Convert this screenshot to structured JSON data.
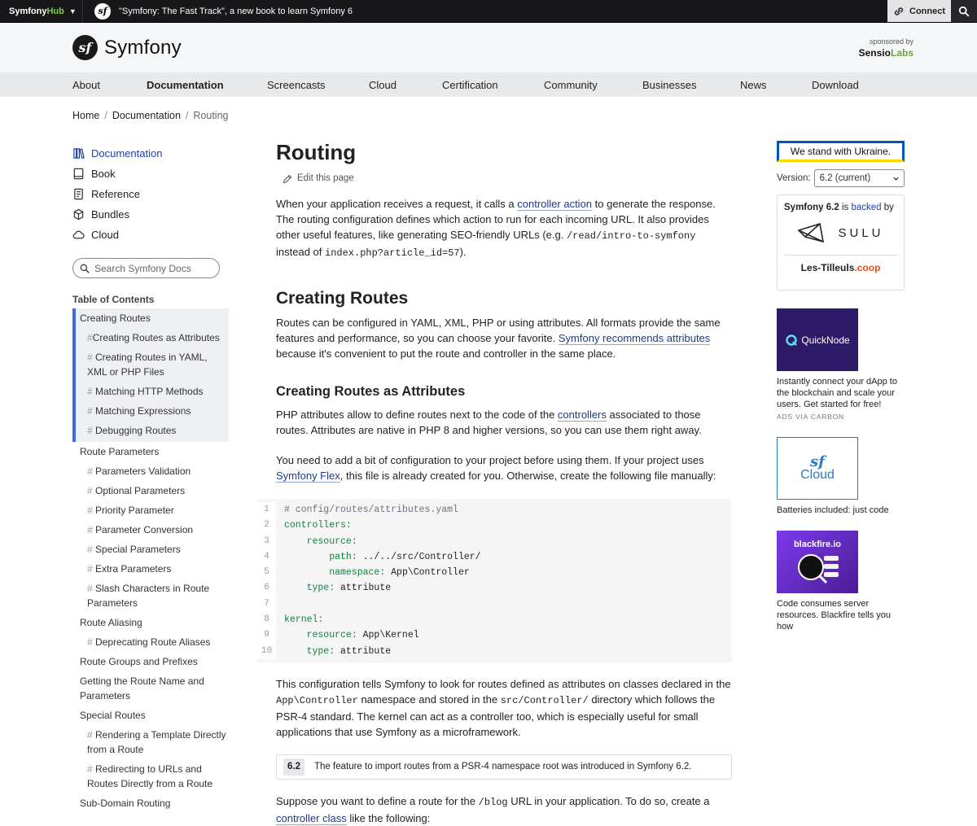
{
  "topbar": {
    "hub_name": "Symfony",
    "hub_name_accent": "Hub",
    "promo_text": "\"Symfony: The Fast Track\", a new book to learn Symfony 6",
    "connect_label": "Connect"
  },
  "header": {
    "logo_text": "Symfony",
    "sponsored_by": "sponsored by",
    "sponsor_name_a": "Sensio",
    "sponsor_name_b": "Labs"
  },
  "nav": {
    "items": [
      "About",
      "Documentation",
      "Screencasts",
      "Cloud",
      "Certification",
      "Community",
      "Businesses",
      "News",
      "Download"
    ],
    "active": "Documentation"
  },
  "breadcrumb": {
    "home": "Home",
    "docs": "Documentation",
    "current": "Routing",
    "sep": "/"
  },
  "sidebar": {
    "docnav": [
      "Documentation",
      "Book",
      "Reference",
      "Bundles",
      "Cloud"
    ],
    "search_placeholder": "Search Symfony Docs",
    "toc_title": "Table of Contents",
    "toc": {
      "g1": "Creating Routes",
      "g1_subs": [
        "Creating Routes as Attributes",
        "Creating Routes in YAML, XML or PHP Files",
        "Matching HTTP Methods",
        "Matching Expressions",
        "Debugging Routes"
      ],
      "g2": "Route Parameters",
      "g2_subs": [
        "Parameters Validation",
        "Optional Parameters",
        "Priority Parameter",
        "Parameter Conversion",
        "Special Parameters",
        "Extra Parameters",
        "Slash Characters in Route Parameters"
      ],
      "g3": "Route Aliasing",
      "g3_subs": [
        "Deprecating Route Aliases"
      ],
      "g4": "Route Groups and Prefixes",
      "g5": "Getting the Route Name and Parameters",
      "g6": "Special Routes",
      "g6_subs": [
        "Rendering a Template Directly from a Route",
        "Redirecting to URLs and Routes Directly from a Route"
      ],
      "g7": "Sub-Domain Routing"
    }
  },
  "main": {
    "title": "Routing",
    "edit_label": "Edit this page",
    "intro": {
      "t1": "When your application receives a request, it calls a ",
      "link1": "controller action",
      "t2": " to generate the response. The routing configuration defines which action to run for each incoming URL. It also provides other useful features, like generating SEO-friendly URLs (e.g. ",
      "code1": "/read/intro-to-symfony",
      "t3": " instead of ",
      "code2": "index.php?article_id=57",
      "t4": ")."
    },
    "h2": "Creating Routes",
    "p2": {
      "t1": "Routes can be configured in YAML, XML, PHP or using attributes. All formats provide the same features and performance, so you can choose your favorite. ",
      "link1": "Symfony recommends attributes",
      "t2": " because it's convenient to put the route and controller in the same place."
    },
    "h3": "Creating Routes as Attributes",
    "p3": {
      "t1": "PHP attributes allow to define routes next to the code of the ",
      "link1": "controllers",
      "t2": " associated to those routes. Attributes are native in PHP 8 and higher versions, so you can use them right away."
    },
    "p4": {
      "t1": "You need to add a bit of configuration to your project before using them. If your project uses ",
      "link1": "Symfony Flex",
      "t2": ", this file is already created for you. Otherwise, create the following file manually:"
    },
    "code_lines": [
      {
        "n": "1",
        "comment": "# config/routes/attributes.yaml",
        "key": "",
        "val": ""
      },
      {
        "n": "2",
        "comment": "",
        "key": "controllers:",
        "val": ""
      },
      {
        "n": "3",
        "comment": "",
        "key": "    resource:",
        "val": ""
      },
      {
        "n": "4",
        "comment": "",
        "key": "        path:",
        "val": " ../../src/Controller/"
      },
      {
        "n": "5",
        "comment": "",
        "key": "        namespace:",
        "val": " App\\Controller"
      },
      {
        "n": "6",
        "comment": "",
        "key": "    type:",
        "val": " attribute"
      },
      {
        "n": "7",
        "comment": "",
        "key": "",
        "val": ""
      },
      {
        "n": "8",
        "comment": "",
        "key": "kernel:",
        "val": ""
      },
      {
        "n": "9",
        "comment": "",
        "key": "    resource:",
        "val": " App\\Kernel"
      },
      {
        "n": "10",
        "comment": "",
        "key": "    type:",
        "val": " attribute"
      }
    ],
    "p5": {
      "t1": "This configuration tells Symfony to look for routes defined as attributes on classes declared in the ",
      "code1": "App\\Controller",
      "t2": " namespace and stored in the ",
      "code2": "src/Controller/",
      "t3": " directory which follows the PSR-4 standard. The kernel can act as a controller too, which is especially useful for small applications that use Symfony as a microframework."
    },
    "note": {
      "version": "6.2",
      "text": "The feature to import routes from a PSR-4 namespace root was introduced in Symfony 6.2."
    },
    "p6": {
      "t1": "Suppose you want to define a route for the ",
      "code1": "/blog",
      "t2": " URL in your application. To do so, create a ",
      "link1": "controller class",
      "t3": " like the following:"
    }
  },
  "right": {
    "ukraine": "We stand with Ukraine.",
    "version_label": "Version:",
    "version_value": "6.2 (current)",
    "backed": {
      "a": "Symfony 6.2",
      "b": " is ",
      "link": "backed",
      "c": " by"
    },
    "sulu": "SULU",
    "tilleuls_a": "Les-Tilleuls",
    "tilleuls_b": ".coop",
    "ad1": {
      "logo": "QuickNode",
      "text": "Instantly connect your dApp to the blockchain and scale your users. Get started for free!",
      "via": "ADS VIA CARBON"
    },
    "ad2": {
      "logo": "Cloud",
      "text": "Batteries included: just code"
    },
    "ad3": {
      "logo": "blackfire.io",
      "text": "Code consumes server resources. Blackfire tells you how"
    }
  },
  "colors": {
    "accent": "#1e40af",
    "ukraine_blue": "#0057b7",
    "ukraine_yellow": "#ffd700",
    "code_key": "#15803d"
  }
}
